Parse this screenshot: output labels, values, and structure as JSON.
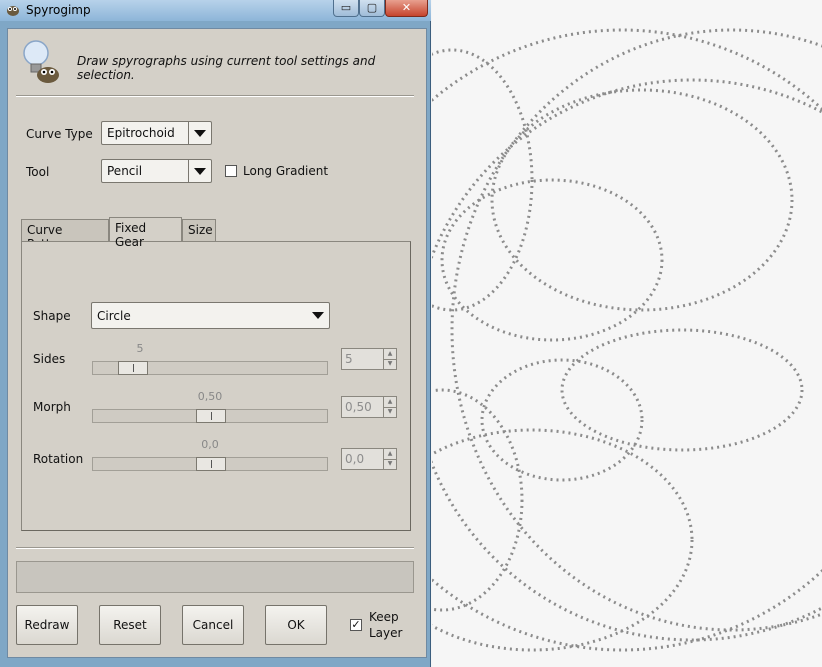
{
  "window": {
    "title": "Spyrogimp",
    "min_glyph": "▭",
    "max_glyph": "▢",
    "close_glyph": "✕"
  },
  "header": {
    "description": "Draw spyrographs using current tool settings and selection."
  },
  "options": {
    "curve_type_label": "Curve Type",
    "curve_type_value": "Epitrochoid",
    "tool_label": "Tool",
    "tool_value": "Pencil",
    "long_gradient_label": "Long Gradient",
    "long_gradient_checked": false
  },
  "tabs": [
    {
      "label": "Curve Pattern",
      "active": false
    },
    {
      "label": "Fixed Gear",
      "active": true
    },
    {
      "label": "Size",
      "active": false
    }
  ],
  "fixed_gear": {
    "shape_label": "Shape",
    "shape_value": "Circle",
    "sides": {
      "label": "Sides",
      "value_text": "5",
      "spin_text": "5",
      "fraction": 0.12
    },
    "morph": {
      "label": "Morph",
      "value_text": "0,50",
      "spin_text": "0,50",
      "fraction": 0.5
    },
    "rotation": {
      "label": "Rotation",
      "value_text": "0,0",
      "spin_text": "0,0",
      "fraction": 0.5
    }
  },
  "buttons": {
    "redraw": "Redraw",
    "reset": "Reset",
    "cancel": "Cancel",
    "ok": "OK",
    "keep_layer": "Keep Layer",
    "keep_layer_checked": true
  },
  "colors": {
    "title_bar": "#8db5d8",
    "dialog_bg": "#d4d0c8",
    "canvas_bg": "#f6f6f6",
    "curve": "#8c8c8c"
  }
}
